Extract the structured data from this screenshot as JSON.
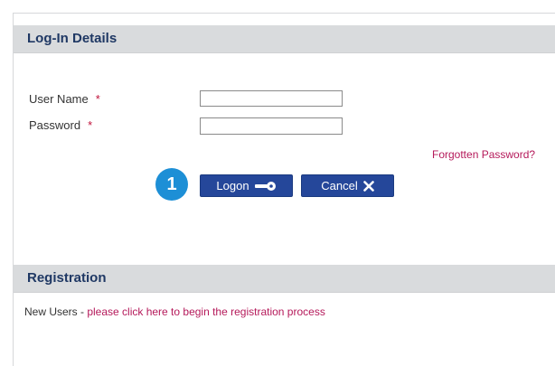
{
  "login": {
    "title": "Log-In Details",
    "username_label": "User Name",
    "password_label": "Password",
    "required_marker": "*",
    "username_value": "",
    "password_value": "",
    "forgot_link": "Forgotten Password?",
    "logon_button": "Logon",
    "cancel_button": "Cancel",
    "step_badge": "1"
  },
  "registration": {
    "title": "Registration",
    "prefix": "New Users - ",
    "link": "please click here to begin the registration process"
  },
  "colors": {
    "header_bg": "#d9dbdd",
    "header_text": "#1f3864",
    "button_bg": "#25479a",
    "link": "#b5195a",
    "badge": "#1d8fd6"
  },
  "icons": {
    "logon": "key-icon",
    "cancel": "close-icon"
  }
}
